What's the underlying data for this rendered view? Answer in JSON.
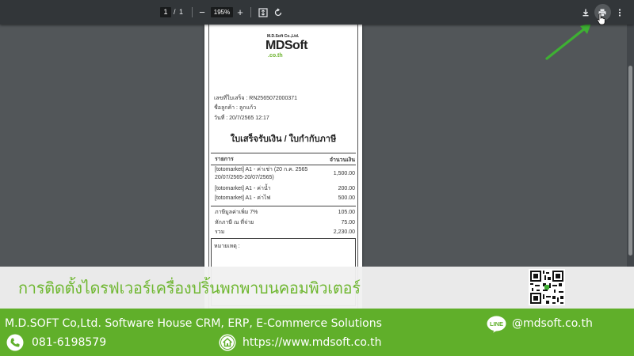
{
  "toolbar": {
    "current_page": "1",
    "page_separator": "/",
    "total_pages": "1",
    "zoom_out": "−",
    "zoom_level": "195%",
    "zoom_in": "+"
  },
  "receipt": {
    "logo_company": "M.D.Soft Co.,Ltd.",
    "logo_main": "MDSoft",
    "logo_sub": ".co.th",
    "receipt_no": "เลขที่ใบเสร็จ : RN2565072000371",
    "customer": "ชื่อลูกค้า : ลูกแก้ว",
    "date": "วันที่ : 20/7/2565 12:17",
    "title": "ใบเสร็จรับเงิน / ใบกำกับภาษี",
    "col_item": "รายการ",
    "col_amount": "จำนวนเงิน",
    "items": [
      {
        "name": "[totomarket] A1 - ค่าเช่า (20 ก.ค. 2565",
        "name2": "20/07/2565-20/07/2565)",
        "amount": "1,500.00"
      },
      {
        "name": "[totomarket] A1 - ค่าน้ำ",
        "name2": "",
        "amount": "200.00"
      },
      {
        "name": "[totomarket] A1 - ค่าไฟ",
        "name2": "",
        "amount": "500.00"
      }
    ],
    "summary": [
      {
        "label": "ภาษีมูลค่าเพิ่ม 7%",
        "amount": "105.00"
      },
      {
        "label": "หักภาษี ณ ที่จ่าย",
        "amount": "75.00"
      },
      {
        "label": "รวม",
        "amount": "2,230.00"
      }
    ],
    "remark": "หมายเหตุ :"
  },
  "banner": {
    "title": "การติดตั้งไดรฟเวอร์เครื่องปริ้นพกพาบนคอมพิวเตอร์"
  },
  "footer": {
    "company": "M.D.SOFT Co,Ltd. Software House CRM, ERP, E-Commerce Solutions",
    "phone": "081-6198579",
    "website": "https://www.mdsoft.co.th",
    "line_id": "@mdsoft.co.th",
    "line_badge": "LINE"
  },
  "colors": {
    "toolbar": "#323639",
    "viewer_bg": "#525659",
    "brand_green": "#60af2a",
    "arrow_green": "#3eb033"
  },
  "icons": [
    "download-icon",
    "print-icon",
    "more-vert-icon",
    "fit-page-icon",
    "rotate-icon",
    "phone-icon",
    "home-icon",
    "line-icon",
    "qr-code"
  ]
}
